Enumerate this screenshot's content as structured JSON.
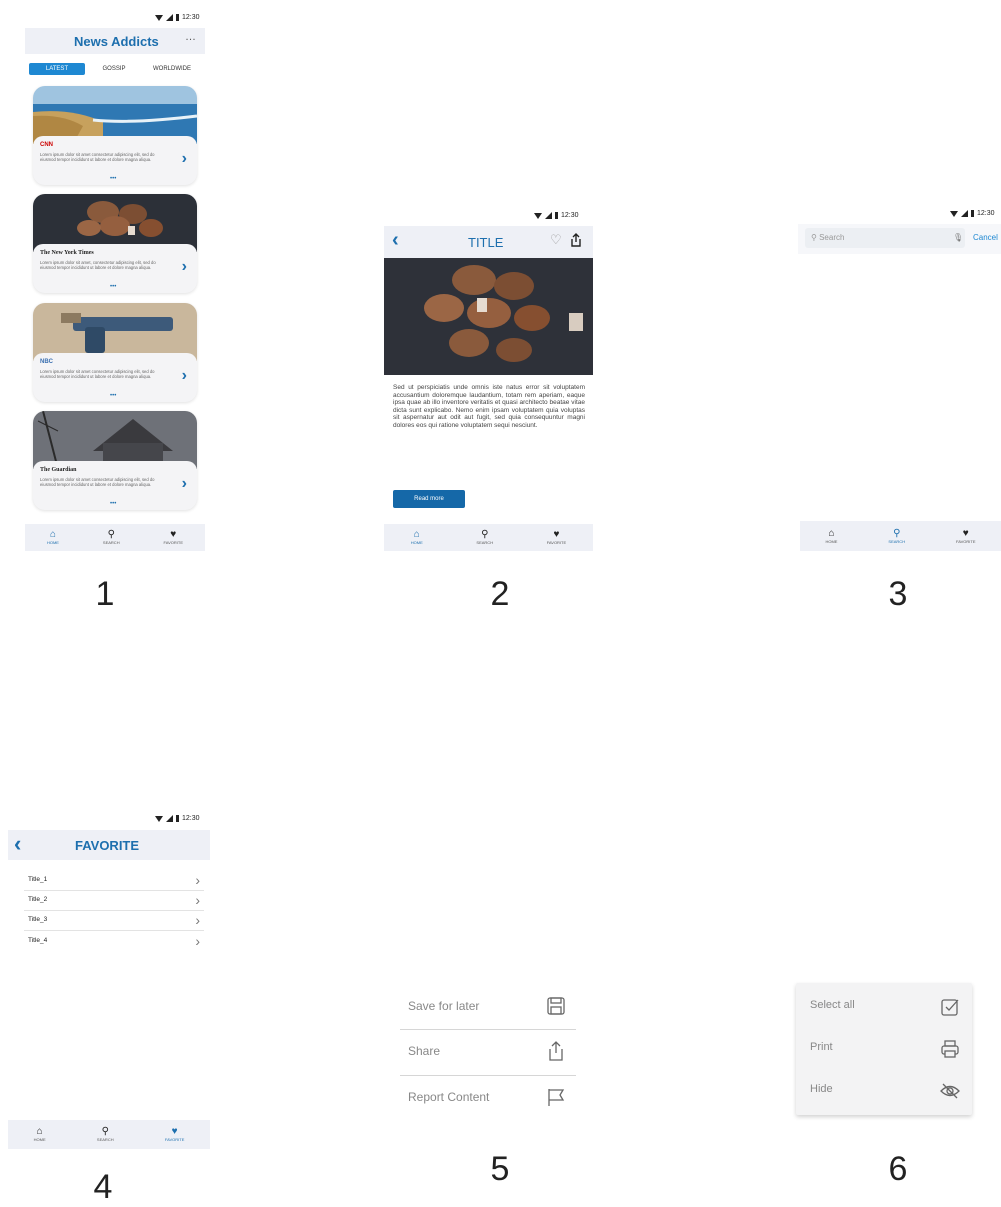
{
  "status_time": "12:30",
  "screen1": {
    "title": "News Addicts",
    "more": "…",
    "tabs": [
      "LATEST",
      "GOSSIP",
      "WORLDWIDE"
    ],
    "cards": [
      {
        "source": "CNN",
        "text": "Lorem ipsum dolor sit amet consectetur adipiscing elit, sed do eiusmod tempor incididunt ut labore et dolore magna aliqua."
      },
      {
        "source": "The New York Times",
        "text": "Lorem ipsum dolor sit amet, consectetur adipiscing elit, sed do eiusmod tempor incididunt ut labore et dolore magna aliqua."
      },
      {
        "source": "NBC",
        "text": "Lorem ipsum dolor sit amet consectetur adipiscing elit, sed do eiusmod tempor incididunt ut labore et dolore magna aliqua."
      },
      {
        "source": "The Guardian",
        "text": "Lorem ipsum dolor sit amet consectetur adipiscing elit, sed do eiusmod tempor incididunt ut labore et dolore magna aliqua."
      }
    ],
    "dots": "•••"
  },
  "nav": {
    "home": "HOME",
    "search": "SEARCH",
    "favorite": "FAVORITE"
  },
  "screen2": {
    "title": "TITLE",
    "body": "Sed ut perspiciatis unde omnis iste natus error sit voluptatem accusantium doloremque laudantium, totam rem aperiam, eaque ipsa quae ab illo inventore veritatis et quasi architecto beatae vitae dicta sunt explicabo. Nemo enim ipsam voluptatem quia voluptas sit aspernatur aut odit aut fugit, sed quia consequuntur magni dolores eos qui ratione voluptatem sequi nesciunt.",
    "read_more": "Read more"
  },
  "screen3": {
    "search_placeholder": "Search",
    "cancel": "Cancel"
  },
  "screen4": {
    "title": "FAVORITE",
    "items": [
      "Title_1",
      "Title_2",
      "Title_3",
      "Title_4"
    ]
  },
  "screen5": {
    "items": [
      "Save for later",
      "Share",
      "Report Content"
    ]
  },
  "screen6": {
    "items": [
      "Select all",
      "Print",
      "Hide"
    ]
  },
  "labels": [
    "1",
    "2",
    "3",
    "4",
    "5",
    "6"
  ],
  "colors": {
    "accent": "#1d6fae",
    "tab_active": "#1e88d2",
    "button": "#1568a8",
    "bar_bg": "#eef0f6"
  }
}
